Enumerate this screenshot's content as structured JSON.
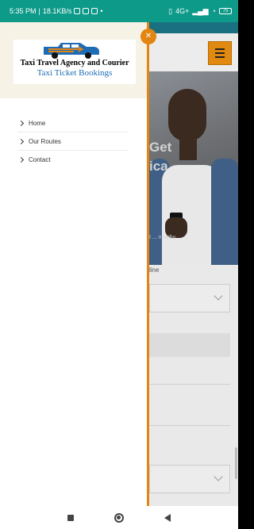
{
  "status_bar": {
    "time": "5:35 PM",
    "speed": "18.1KB/s",
    "network": "4G+",
    "battery": "75"
  },
  "drawer": {
    "logo": {
      "title": "Taxi Travel Agency and Courier",
      "subtitle": "Taxi Ticket Bookings"
    },
    "nav_items": [
      {
        "label": "Home"
      },
      {
        "label": "Our Routes"
      },
      {
        "label": "Contact"
      }
    ],
    "close_icon": "close-icon",
    "accent_color": "#e38513"
  },
  "background_page": {
    "hero_title_1": "Get",
    "hero_title_2": "ica",
    "hero_sub": "t ... nearby",
    "form_label": "line",
    "menu_color": "#e28a10"
  }
}
